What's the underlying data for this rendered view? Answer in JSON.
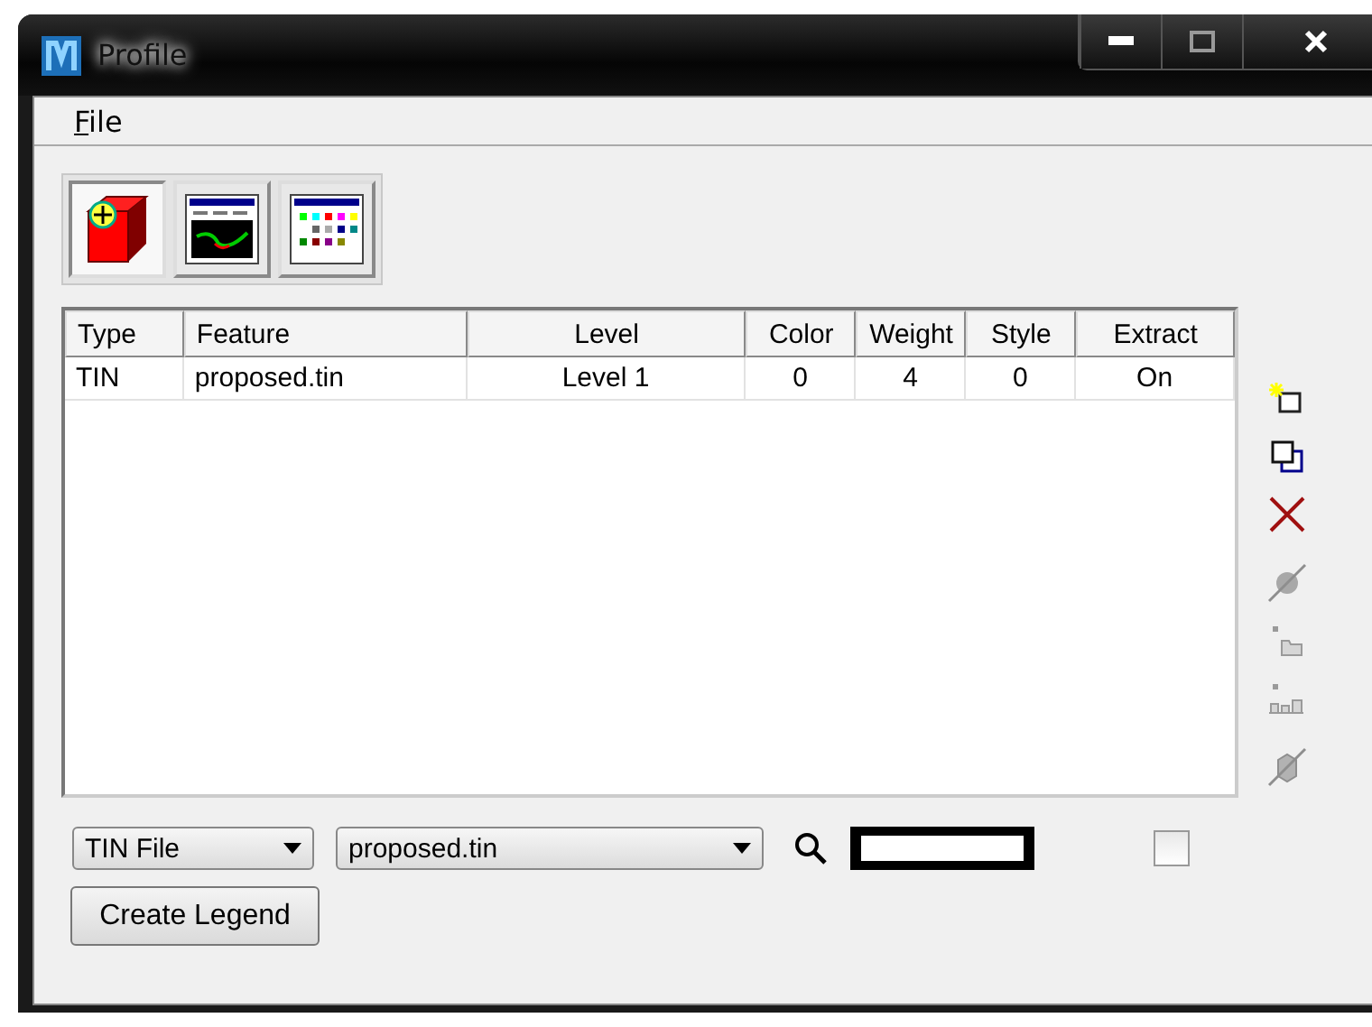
{
  "window": {
    "title": "Profile"
  },
  "menu": [
    {
      "label": "File"
    }
  ],
  "toolbar": [
    {
      "kind": "solid",
      "selected": true
    },
    {
      "kind": "profile",
      "selected": false
    },
    {
      "kind": "palette",
      "selected": false
    }
  ],
  "table": {
    "columns": [
      "Type",
      "Feature",
      "Level",
      "Color",
      "Weight",
      "Style",
      "Extract"
    ],
    "rows": [
      {
        "cells": [
          "TIN",
          "proposed.tin",
          "Level 1",
          "0",
          "4",
          "0",
          "On"
        ],
        "selected": false
      }
    ]
  },
  "side_tools": [
    {
      "kind": "new",
      "disabled": false
    },
    {
      "kind": "copy",
      "disabled": false
    },
    {
      "kind": "delete",
      "disabled": false
    },
    {
      "kind": "disable",
      "disabled": true
    },
    {
      "kind": "single",
      "disabled": true
    },
    {
      "kind": "multi",
      "disabled": true
    },
    {
      "kind": "cube",
      "disabled": true
    }
  ],
  "type_dropdown": {
    "value": "TIN File"
  },
  "file_dropdown": {
    "value": "proposed.tin"
  },
  "extract_checkbox": {
    "checked": false
  },
  "create_button": {
    "label": "Create Legend"
  }
}
